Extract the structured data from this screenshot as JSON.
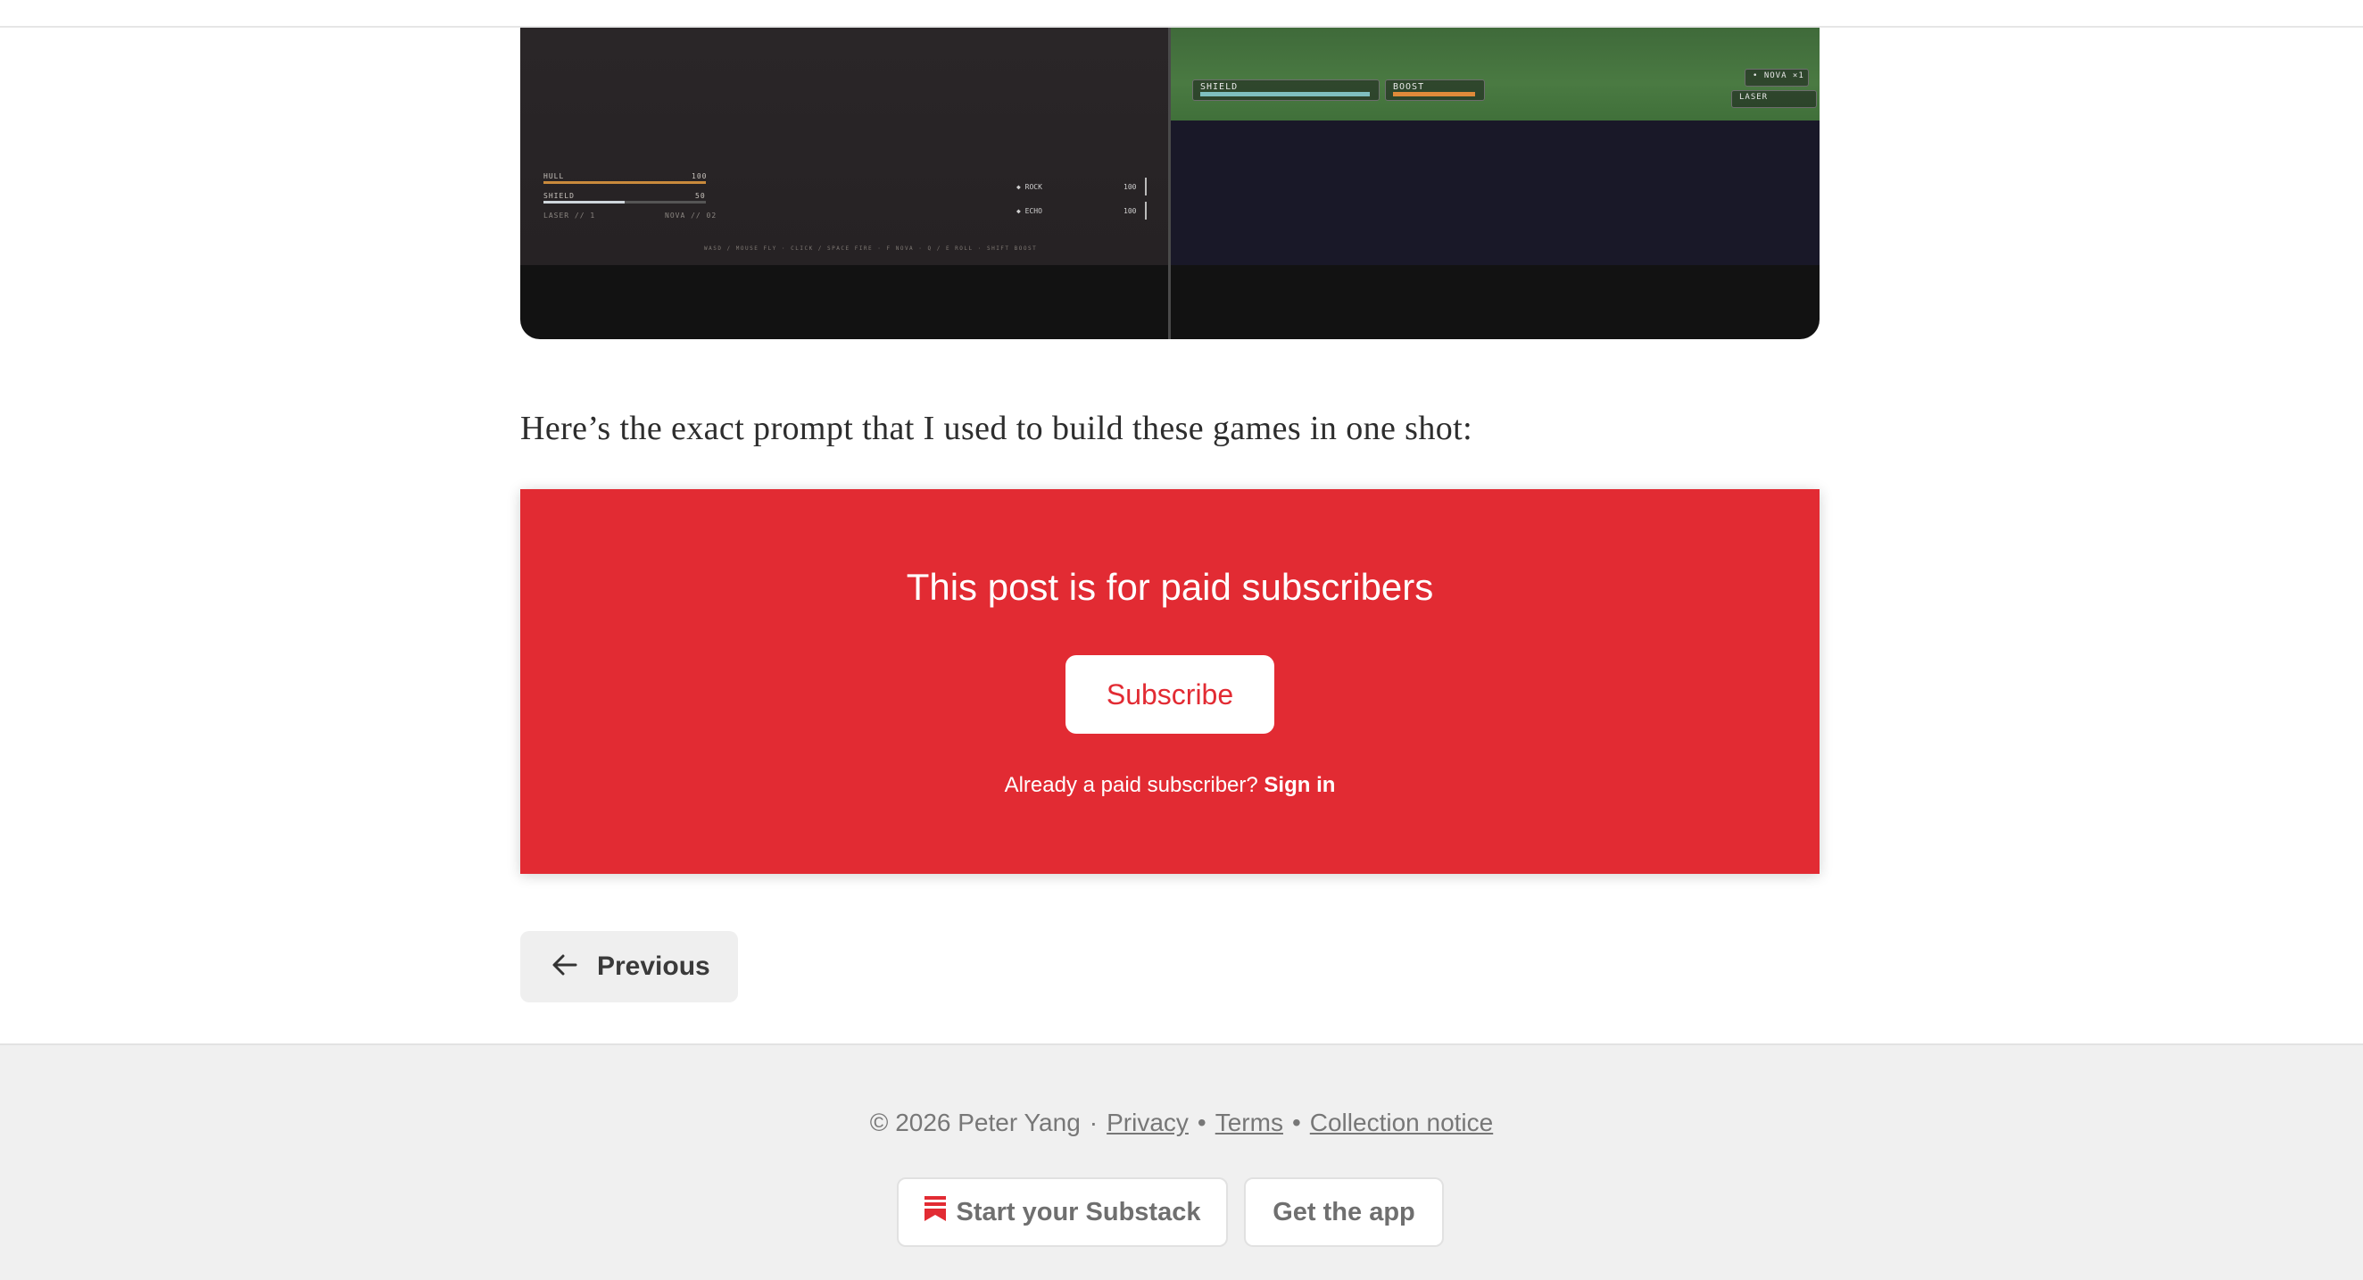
{
  "figure": {
    "left_hud": {
      "hull_label": "HULL",
      "hull_value": "100",
      "shield_label": "SHIELD",
      "shield_value": "50",
      "weapon_left": "LASER // 1",
      "weapon_right": "NOVA // 02",
      "meters": [
        {
          "label": "◆ ROCK",
          "value": "100"
        },
        {
          "label": "◆ ECHO",
          "value": "100"
        }
      ],
      "controls": "WASD / MOUSE FLY · CLICK / SPACE FIRE · F NOVA · Q / E ROLL · SHIFT BOOST"
    },
    "right_hud": {
      "shield_label": "SHIELD",
      "boost_label": "BOOST",
      "nova_label": "• NOVA ×1",
      "laser_label": "LASER"
    }
  },
  "lead_text": "Here’s the exact prompt that I used to build these games in one shot:",
  "paywall": {
    "title": "This post is for paid subscribers",
    "subscribe_label": "Subscribe",
    "already_text": "Already a paid subscriber?",
    "signin_label": "Sign in"
  },
  "nav": {
    "previous_label": "Previous"
  },
  "footer": {
    "copyright": "© 2026 Peter Yang",
    "privacy": "Privacy",
    "terms": "Terms",
    "collection": "Collection notice",
    "start_label": "Start your Substack",
    "app_label": "Get the app"
  },
  "colors": {
    "accent": "#e22b33"
  }
}
